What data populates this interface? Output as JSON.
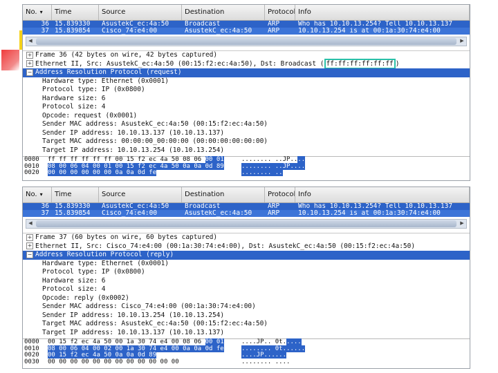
{
  "columns": {
    "no": "No.",
    "time": "Time",
    "source": "Source",
    "destination": "Destination",
    "protocol": "Protocol",
    "info": "Info"
  },
  "panels": [
    {
      "packets": [
        {
          "no": "36",
          "time": "15.839330",
          "source": "AsustekC_ec:4a:50",
          "destination": "Broadcast",
          "protocol": "ARP",
          "info": "Who has 10.10.13.254?  Tell 10.10.13.137"
        },
        {
          "no": "37",
          "time": "15.839854",
          "source": "Cisco_74:e4:00",
          "destination": "AsustekC_ec:4a:50",
          "protocol": "ARP",
          "info": "10.10.13.254 is at 00:1a:30:74:e4:00"
        }
      ],
      "tree": {
        "frame": "Frame 36 (42 bytes on wire, 42 bytes captured)",
        "ethernet_prefix": "Ethernet II, Src: AsustekC_ec:4a:50 (00:15:f2:ec:4a:50), Dst: Broadcast (",
        "ethernet_dst_mac": "ff:ff:ff:ff:ff:ff",
        "ethernet_suffix": ")",
        "arp": "Address Resolution Protocol (request)",
        "fields": [
          "Hardware type: Ethernet (0x0001)",
          "Protocol type: IP (0x0800)",
          "Hardware size: 6",
          "Protocol size: 4",
          "Opcode: request (0x0001)",
          "Sender MAC address: AsustekC_ec:4a:50 (00:15:f2:ec:4a:50)",
          "Sender IP address: 10.10.13.137 (10.10.13.137)",
          "Target MAC address: 00:00:00_00:00:00 (00:00:00:00:00:00)",
          "Target IP address: 10.10.13.254 (10.10.13.254)"
        ]
      },
      "hex": [
        {
          "offset": "0000",
          "plain": "ff ff ff ff ff ff 00 15  f2 ec 4a 50 08 06 ",
          "hl": "00 01",
          "ascii_plain": "........ ..JP..",
          "ascii_hl": ".."
        },
        {
          "offset": "0010",
          "plain": "",
          "hl": "08 00 06 04 00 01 00 15  f2 ec 4a 50 0a 0a 0d 89",
          "ascii_plain": "",
          "ascii_hl": "........ ..JP...."
        },
        {
          "offset": "0020",
          "plain": "",
          "hl": "00 00 00 00 00 00 0a 0a  0d fe",
          "ascii_plain": "",
          "ascii_hl": "........ .."
        }
      ]
    },
    {
      "packets": [
        {
          "no": "36",
          "time": "15.839330",
          "source": "AsustekC_ec:4a:50",
          "destination": "Broadcast",
          "protocol": "ARP",
          "info": "Who has 10.10.13.254?  Tell 10.10.13.137"
        },
        {
          "no": "37",
          "time": "15.839854",
          "source": "Cisco_74:e4:00",
          "destination": "AsustekC_ec:4a:50",
          "protocol": "ARP",
          "info": "10.10.13.254 is at 00:1a:30:74:e4:00"
        }
      ],
      "tree": {
        "frame": "Frame 37 (60 bytes on wire, 60 bytes captured)",
        "ethernet": "Ethernet II, Src: Cisco_74:e4:00 (00:1a:30:74:e4:00), Dst: AsustekC_ec:4a:50 (00:15:f2:ec:4a:50)",
        "arp": "Address Resolution Protocol (reply)",
        "fields": [
          "Hardware type: Ethernet (0x0001)",
          "Protocol type: IP (0x0800)",
          "Hardware size: 6",
          "Protocol size: 4",
          "Opcode: reply (0x0002)",
          "Sender MAC address: Cisco_74:e4:00 (00:1a:30:74:e4:00)",
          "Sender IP address: 10.10.13.254 (10.10.13.254)",
          "Target MAC address: AsustekC_ec:4a:50 (00:15:f2:ec:4a:50)",
          "Target IP address: 10.10.13.137 (10.10.13.137)"
        ]
      },
      "hex": [
        {
          "offset": "0000",
          "plain": "00 15 f2 ec 4a 50 00 1a  30 74 e4 00 08 06 ",
          "hl": "00 01",
          "ascii_plain": "....JP.. 0t.",
          "ascii_hl": "...."
        },
        {
          "offset": "0010",
          "plain": "",
          "hl": "08 00 06 04 00 02 00 1a  30 74 e4 00 0a 0a 0d fe",
          "ascii_plain": "",
          "ascii_hl": "........ 0t......"
        },
        {
          "offset": "0020",
          "plain": "",
          "hl": "00 15 f2 ec 4a 50 0a 0a  0d 89",
          "ascii_plain": "",
          "ascii_hl": "....JP......"
        },
        {
          "offset": "0030",
          "plain": "00 00 00 00 00 00 00 00  00 00 00 00",
          "hl": "",
          "ascii_plain": "........ ....",
          "ascii_hl": ""
        }
      ]
    }
  ],
  "colors": {
    "selection": "#2d63c8",
    "highlight_box": "#29c0a8",
    "deco_red": "#f03c3c",
    "deco_yellow": "#f5d21a"
  }
}
